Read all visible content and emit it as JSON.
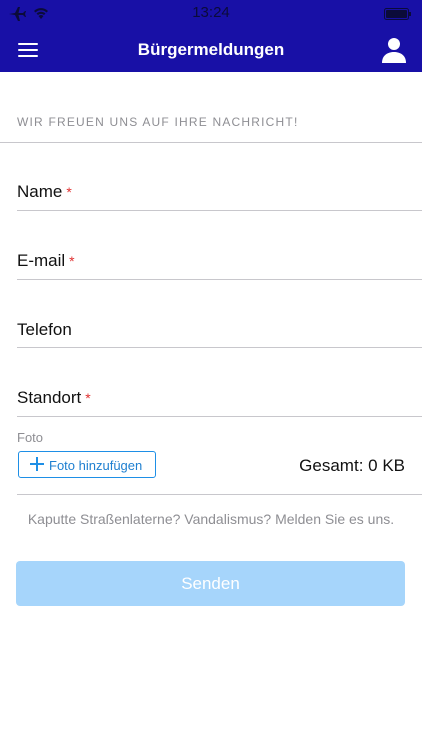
{
  "status_bar": {
    "time": "13:24",
    "airplane_icon": "airplane-icon",
    "wifi_icon": "wifi-icon",
    "battery_icon": "battery-icon"
  },
  "nav": {
    "title": "Bürgermeldungen",
    "menu_icon": "hamburger-menu-icon",
    "profile_icon": "user-icon",
    "background_color": "#1810a6"
  },
  "form": {
    "section_header": "WIR FREUEN UNS AUF IHRE NACHRICHT!",
    "fields": [
      {
        "label": "Name",
        "required": true,
        "required_mark": "*",
        "value": ""
      },
      {
        "label": "E-mail",
        "required": true,
        "required_mark": "*",
        "value": ""
      },
      {
        "label": "Telefon",
        "required": false,
        "value": ""
      },
      {
        "label": "Standort",
        "required": true,
        "required_mark": "*",
        "value": ""
      }
    ],
    "photo": {
      "label": "Foto",
      "add_button_label": "Foto hinzufügen",
      "add_icon": "plus-icon",
      "total_label": "Gesamt: 0 KB"
    },
    "hint": "Kaputte Straßenlaterne? Vandalismus? Melden Sie es uns.",
    "submit_label": "Senden",
    "submit_color": "#a6d5fb",
    "required_color": "#e03030",
    "accent_color": "#1e8fe6"
  }
}
